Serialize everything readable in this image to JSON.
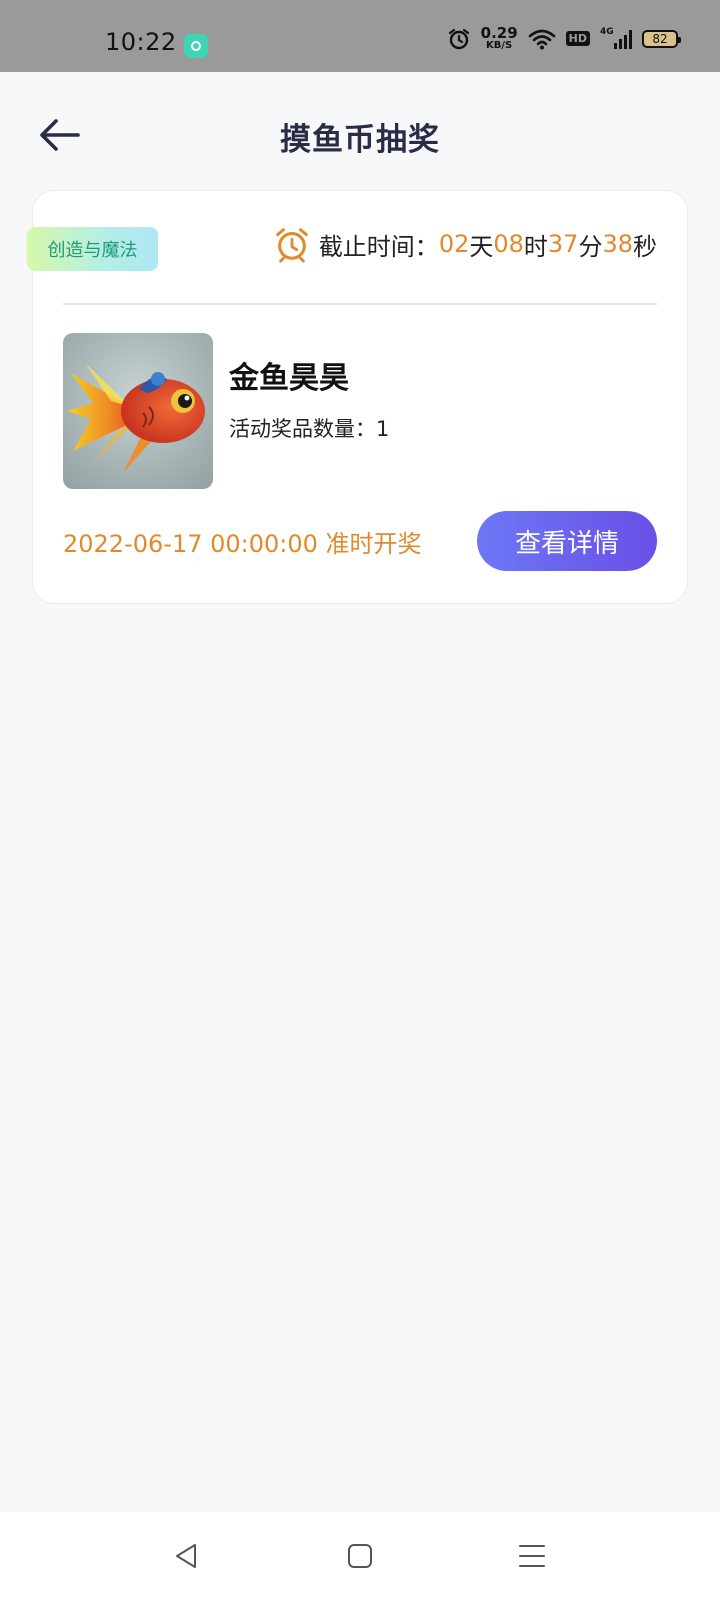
{
  "status_bar": {
    "time": "10:22",
    "net_speed_value": "0.29",
    "net_speed_unit": "KB/S",
    "hd_label": "HD",
    "network_label": "4G",
    "battery_level": "82",
    "icons": [
      "app-notification-icon",
      "alarm-icon",
      "wifi-icon",
      "hd-icon",
      "signal-icon",
      "battery-icon"
    ]
  },
  "header": {
    "title": "摸鱼币抽奖",
    "back_icon": "arrow-left-icon"
  },
  "card": {
    "category_tag": "创造与魔法",
    "deadline": {
      "label": "截止时间：",
      "days": "02",
      "days_unit": "天",
      "hours": "08",
      "hours_unit": "时",
      "minutes": "37",
      "minutes_unit": "分",
      "seconds": "38",
      "seconds_unit": "秒",
      "icon": "alarm-clock-icon"
    },
    "prize_name": "金鱼昊昊",
    "prize_count": "活动奖品数量：1",
    "draw_time": "2022-06-17 00:00:00 准时开奖",
    "detail_button": "查看详情"
  },
  "nav_bar": {
    "back": "triangle-back-icon",
    "home": "square-home-icon",
    "menu": "three-line-menu-icon"
  },
  "colors": {
    "accent_orange": "#e08a2c",
    "button_gradient_start": "#6c78f6",
    "button_gradient_end": "#6a4fe6",
    "title_color": "#2a2d45"
  }
}
